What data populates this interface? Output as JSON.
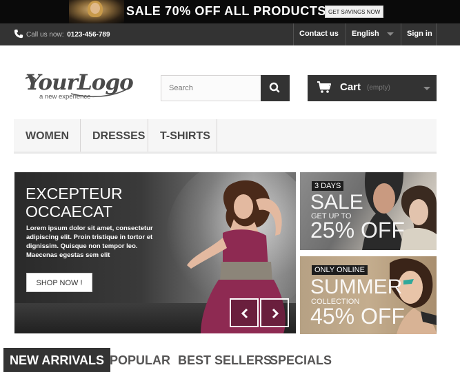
{
  "promo": {
    "headline": "SALE 70% OFF ALL PRODUCTS",
    "button_label": "GET SAVINGS NOW"
  },
  "nav": {
    "phone_label": "Call us now:",
    "phone_number": "0123-456-789",
    "contact_label": "Contact us",
    "language_label": "English",
    "signin_label": "Sign in"
  },
  "logo": {
    "name": "YourLogo",
    "tagline": "a new experience"
  },
  "search": {
    "placeholder": "Search",
    "icon": "search-icon"
  },
  "cart": {
    "label": "Cart",
    "status": "(empty)",
    "icon": "cart-icon"
  },
  "menu": {
    "items": [
      {
        "label": "Women"
      },
      {
        "label": "Dresses"
      },
      {
        "label": "T-shirts"
      }
    ]
  },
  "slider": {
    "title_line1": "Excepteur",
    "title_line2": "Occaecat",
    "text": "Lorem ipsum dolor sit amet, consectetur adipiscing elit. Proin tristique in tortor et dignissim. Quisque non tempor leo. Maecenas egestas sem elit",
    "button_label": "SHOP NOW !"
  },
  "banners": [
    {
      "tag": "3 DAYS",
      "big1": "SALE",
      "small": "GET UP TO",
      "big2": "25% OFF"
    },
    {
      "tag": "ONLY ONLINE",
      "big1": "SUMMER",
      "small": "COLLECTION",
      "big2": "45% OFF"
    }
  ],
  "tabs": [
    {
      "label": "New Arrivals",
      "active": true
    },
    {
      "label": "Popular",
      "active": false
    },
    {
      "label": "Best Sellers",
      "active": false
    },
    {
      "label": "Specials",
      "active": false
    }
  ],
  "colors": {
    "dark": "#333333",
    "black": "#0a0a0a",
    "menu_bg": "#f6f6f6",
    "white": "#ffffff"
  }
}
